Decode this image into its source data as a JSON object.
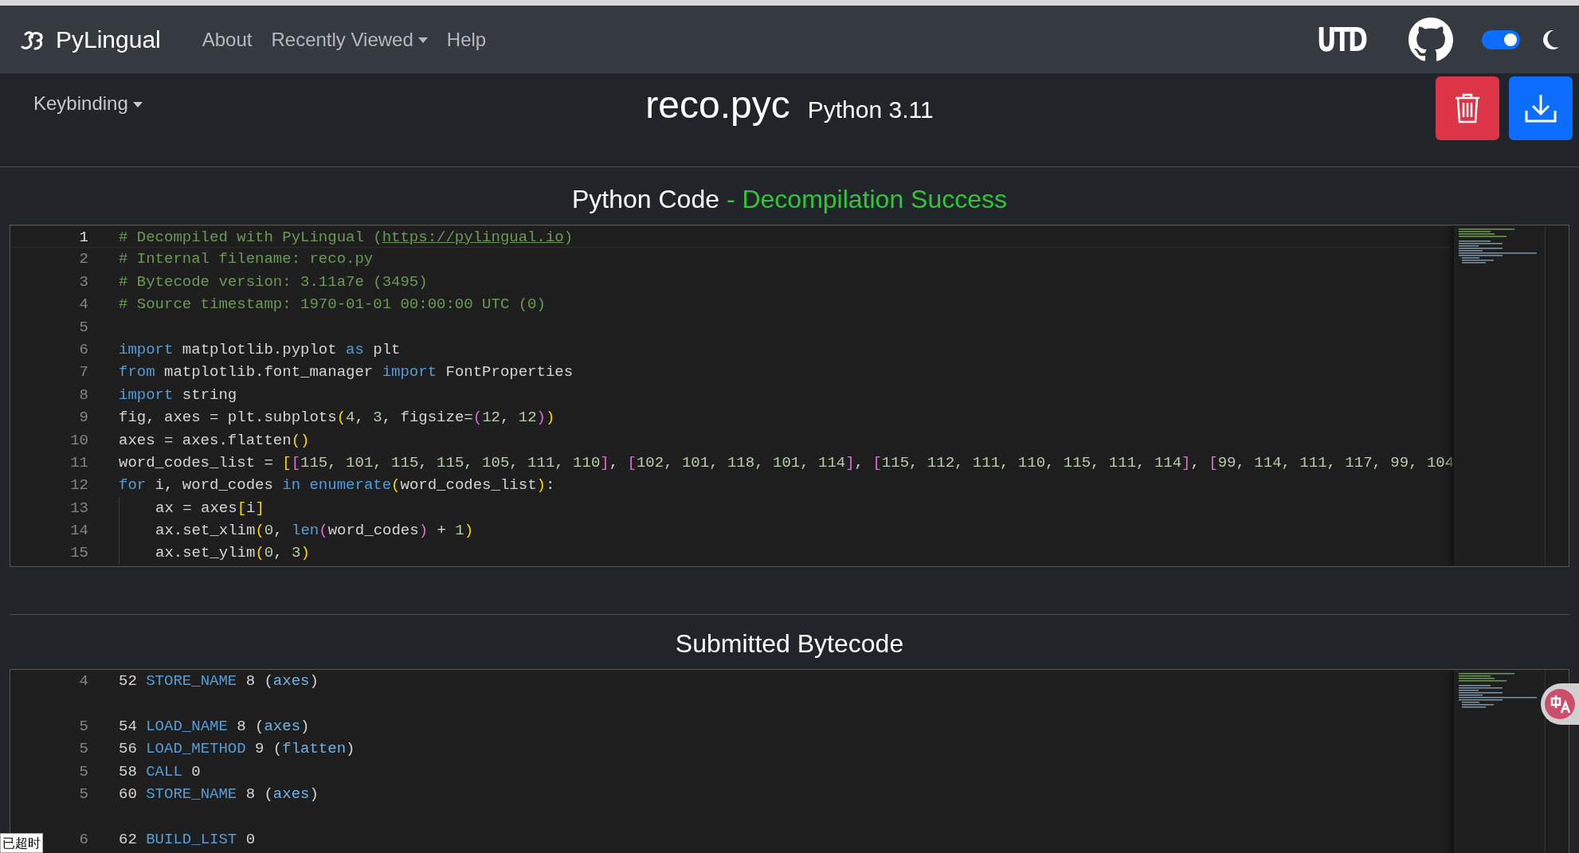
{
  "navbar": {
    "brand": "PyLingual",
    "links": [
      {
        "label": "About",
        "dropdown": false
      },
      {
        "label": "Recently Viewed",
        "dropdown": true
      },
      {
        "label": "Help",
        "dropdown": false
      }
    ],
    "logo_text": "UTD",
    "theme_toggle": {
      "on": true
    }
  },
  "toolbar": {
    "keybinding": "Keybinding",
    "file_name": "reco.pyc",
    "version": "Python 3.11"
  },
  "code_panel": {
    "title": "Python Code",
    "status": "- Decompilation Success",
    "lines": [
      {
        "n": "1",
        "selected": true,
        "tokens": [
          {
            "kind": "comment",
            "text": "# Decompiled with PyLingual ("
          },
          {
            "kind": "link",
            "text": "https://pylingual.io"
          },
          {
            "kind": "comment",
            "text": ")"
          }
        ]
      },
      {
        "n": "2",
        "selected": false,
        "tokens": [
          {
            "kind": "comment",
            "text": "# Internal filename: reco.py"
          }
        ]
      },
      {
        "n": "3",
        "selected": false,
        "tokens": [
          {
            "kind": "comment",
            "text": "# Bytecode version: 3.11a7e (3495)"
          }
        ]
      },
      {
        "n": "4",
        "selected": false,
        "tokens": [
          {
            "kind": "comment",
            "text": "# Source timestamp: 1970-01-01 00:00:00 UTC (0)"
          }
        ]
      },
      {
        "n": "5",
        "selected": false
      },
      {
        "n": "6",
        "selected": false,
        "tokens": [
          {
            "kind": "keyword",
            "text": "import"
          },
          {
            "kind": "plain",
            "text": " matplotlib.pyplot "
          },
          {
            "kind": "keyword",
            "text": "as"
          },
          {
            "kind": "plain",
            "text": " plt"
          }
        ]
      },
      {
        "n": "7",
        "selected": false,
        "tokens": [
          {
            "kind": "keyword",
            "text": "from"
          },
          {
            "kind": "plain",
            "text": " matplotlib.font_manager "
          },
          {
            "kind": "keyword",
            "text": "import"
          },
          {
            "kind": "plain",
            "text": " FontProperties"
          }
        ]
      },
      {
        "n": "8",
        "selected": false,
        "tokens": [
          {
            "kind": "keyword",
            "text": "import"
          },
          {
            "kind": "plain",
            "text": " string"
          }
        ]
      },
      {
        "n": "9",
        "selected": false,
        "tokens": [
          {
            "kind": "plain",
            "text": "fig, axes = plt.subplots"
          },
          {
            "kind": "b1",
            "text": "("
          },
          {
            "kind": "number",
            "text": "4"
          },
          {
            "kind": "plain",
            "text": ","
          },
          {
            "kind": "number",
            "text": " 3"
          },
          {
            "kind": "plain",
            "text": ", figsize="
          },
          {
            "kind": "b2",
            "text": "("
          },
          {
            "kind": "number",
            "text": "12"
          },
          {
            "kind": "plain",
            "text": ","
          },
          {
            "kind": "number",
            "text": " 12"
          },
          {
            "kind": "b2",
            "text": ")"
          },
          {
            "kind": "b1",
            "text": ")"
          }
        ]
      },
      {
        "n": "10",
        "selected": false,
        "tokens": [
          {
            "kind": "plain",
            "text": "axes = axes.flatten"
          },
          {
            "kind": "b1",
            "text": "()"
          }
        ]
      },
      {
        "n": "11",
        "selected": false,
        "tokens": [
          {
            "kind": "plain",
            "text": "word_codes_list ="
          },
          {
            "kind": "b1",
            "text": " ["
          },
          {
            "kind": "b2",
            "text": "["
          },
          {
            "kind": "number",
            "text": "115, 101, 115, 115, 105, 111, 110"
          },
          {
            "kind": "b2",
            "text": "]"
          },
          {
            "kind": "plain",
            "text": ","
          },
          {
            "kind": "b2",
            "text": " ["
          },
          {
            "kind": "number",
            "text": "102, 101, 118, 101, 114"
          },
          {
            "kind": "b2",
            "text": "]"
          },
          {
            "kind": "plain",
            "text": ","
          },
          {
            "kind": "b2",
            "text": " ["
          },
          {
            "kind": "number",
            "text": "115, 112, 111, 110, 115, 111, 114"
          },
          {
            "kind": "b2",
            "text": "]"
          },
          {
            "kind": "plain",
            "text": ","
          },
          {
            "kind": "b2",
            "text": " ["
          },
          {
            "kind": "number",
            "text": "99, 114, 111, 117, 99, 104"
          }
        ]
      },
      {
        "n": "12",
        "selected": false,
        "tokens": [
          {
            "kind": "keyword",
            "text": "for"
          },
          {
            "kind": "plain",
            "text": " i, word_codes "
          },
          {
            "kind": "keyword",
            "text": "in"
          },
          {
            "kind": "func",
            "text": " enumerate"
          },
          {
            "kind": "b1",
            "text": "("
          },
          {
            "kind": "plain",
            "text": "word_codes_list"
          },
          {
            "kind": "b1",
            "text": ")"
          },
          {
            "kind": "plain",
            "text": ":"
          }
        ]
      },
      {
        "n": "13",
        "selected": false,
        "indented": true,
        "tokens": [
          {
            "kind": "plain",
            "text": "ax = axes"
          },
          {
            "kind": "b1",
            "text": "["
          },
          {
            "kind": "plain",
            "text": "i"
          },
          {
            "kind": "b1",
            "text": "]"
          }
        ]
      },
      {
        "n": "14",
        "selected": false,
        "indented": true,
        "tokens": [
          {
            "kind": "plain",
            "text": "ax.set_xlim"
          },
          {
            "kind": "b1",
            "text": "("
          },
          {
            "kind": "number",
            "text": "0"
          },
          {
            "kind": "plain",
            "text": ","
          },
          {
            "kind": "func",
            "text": " len"
          },
          {
            "kind": "b2",
            "text": "("
          },
          {
            "kind": "plain",
            "text": "word_codes"
          },
          {
            "kind": "b2",
            "text": ")"
          },
          {
            "kind": "plain",
            "text": " +"
          },
          {
            "kind": "number",
            "text": " 1"
          },
          {
            "kind": "b1",
            "text": ")"
          }
        ]
      },
      {
        "n": "15",
        "selected": false,
        "indented": true,
        "tokens": [
          {
            "kind": "plain",
            "text": "ax.set_ylim"
          },
          {
            "kind": "b1",
            "text": "("
          },
          {
            "kind": "number",
            "text": "0"
          },
          {
            "kind": "plain",
            "text": ","
          },
          {
            "kind": "number",
            "text": " 3"
          },
          {
            "kind": "b1",
            "text": ")"
          }
        ]
      }
    ]
  },
  "bytecode_panel": {
    "title": "Submitted Bytecode",
    "groups": [
      {
        "lines": [
          {
            "n": "4",
            "tokens": [
              {
                "kind": "plain",
                "text": "52"
              },
              {
                "kind": "keyword",
                "text": " STORE_NAME"
              },
              {
                "kind": "plain",
                "text": " 8 ("
              },
              {
                "kind": "name",
                "text": "axes"
              },
              {
                "kind": "plain",
                "text": ")"
              }
            ]
          }
        ]
      },
      {
        "lines": [
          {
            "n": "5",
            "tokens": [
              {
                "kind": "plain",
                "text": "54"
              },
              {
                "kind": "keyword",
                "text": " LOAD_NAME"
              },
              {
                "kind": "plain",
                "text": " 8 ("
              },
              {
                "kind": "name",
                "text": "axes"
              },
              {
                "kind": "plain",
                "text": ")"
              }
            ]
          },
          {
            "n": "5",
            "tokens": [
              {
                "kind": "plain",
                "text": "56"
              },
              {
                "kind": "keyword",
                "text": " LOAD_METHOD"
              },
              {
                "kind": "plain",
                "text": " 9 ("
              },
              {
                "kind": "name",
                "text": "flatten"
              },
              {
                "kind": "plain",
                "text": ")"
              }
            ]
          },
          {
            "n": "5",
            "tokens": [
              {
                "kind": "plain",
                "text": "58"
              },
              {
                "kind": "keyword",
                "text": " CALL"
              },
              {
                "kind": "plain",
                "text": " 0"
              }
            ]
          },
          {
            "n": "5",
            "tokens": [
              {
                "kind": "plain",
                "text": "60"
              },
              {
                "kind": "keyword",
                "text": " STORE_NAME"
              },
              {
                "kind": "plain",
                "text": " 8 ("
              },
              {
                "kind": "name",
                "text": "axes"
              },
              {
                "kind": "plain",
                "text": ")"
              }
            ]
          }
        ]
      },
      {
        "lines": [
          {
            "n": "6",
            "tokens": [
              {
                "kind": "plain",
                "text": "62"
              },
              {
                "kind": "keyword",
                "text": " BUILD_LIST"
              },
              {
                "kind": "plain",
                "text": " 0"
              }
            ]
          }
        ]
      }
    ]
  },
  "overlay": {
    "timeout_badge": "已超时"
  }
}
